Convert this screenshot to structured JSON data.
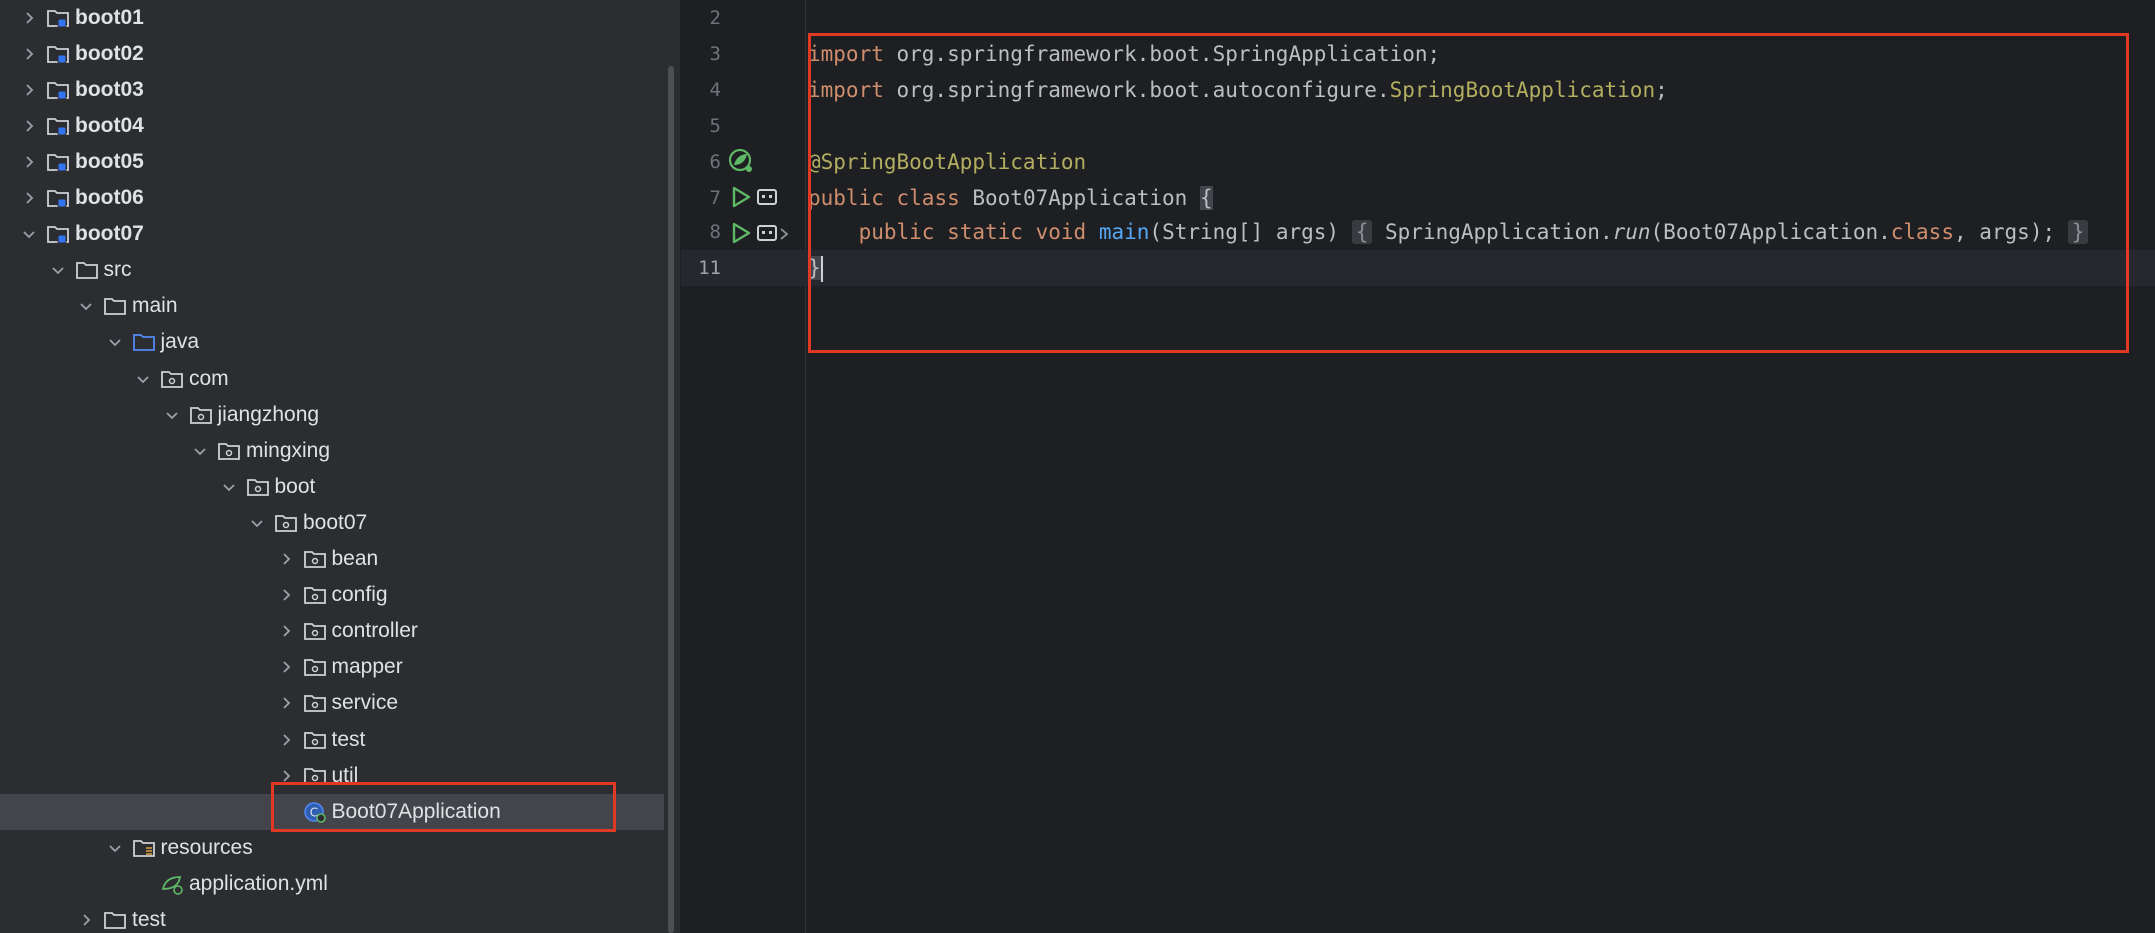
{
  "project_tree": {
    "items": [
      {
        "label": "boot01",
        "level": 0,
        "expanded": false,
        "icon": "module-folder-icon",
        "bold": true
      },
      {
        "label": "boot02",
        "level": 0,
        "expanded": false,
        "icon": "module-folder-icon",
        "bold": true
      },
      {
        "label": "boot03",
        "level": 0,
        "expanded": false,
        "icon": "module-folder-icon",
        "bold": true
      },
      {
        "label": "boot04",
        "level": 0,
        "expanded": false,
        "icon": "module-folder-icon",
        "bold": true
      },
      {
        "label": "boot05",
        "level": 0,
        "expanded": false,
        "icon": "module-folder-icon",
        "bold": true
      },
      {
        "label": "boot06",
        "level": 0,
        "expanded": false,
        "icon": "module-folder-icon",
        "bold": true
      },
      {
        "label": "boot07",
        "level": 0,
        "expanded": true,
        "icon": "module-folder-icon",
        "bold": true
      },
      {
        "label": "src",
        "level": 1,
        "expanded": true,
        "icon": "folder-icon"
      },
      {
        "label": "main",
        "level": 2,
        "expanded": true,
        "icon": "folder-icon"
      },
      {
        "label": "java",
        "level": 3,
        "expanded": true,
        "icon": "source-folder-icon"
      },
      {
        "label": "com",
        "level": 4,
        "expanded": true,
        "icon": "package-icon"
      },
      {
        "label": "jiangzhong",
        "level": 5,
        "expanded": true,
        "icon": "package-icon"
      },
      {
        "label": "mingxing",
        "level": 6,
        "expanded": true,
        "icon": "package-icon"
      },
      {
        "label": "boot",
        "level": 7,
        "expanded": true,
        "icon": "package-icon"
      },
      {
        "label": "boot07",
        "level": 8,
        "expanded": true,
        "icon": "package-icon"
      },
      {
        "label": "bean",
        "level": 9,
        "expanded": false,
        "icon": "package-icon"
      },
      {
        "label": "config",
        "level": 9,
        "expanded": false,
        "icon": "package-icon"
      },
      {
        "label": "controller",
        "level": 9,
        "expanded": false,
        "icon": "package-icon"
      },
      {
        "label": "mapper",
        "level": 9,
        "expanded": false,
        "icon": "package-icon"
      },
      {
        "label": "service",
        "level": 9,
        "expanded": false,
        "icon": "package-icon"
      },
      {
        "label": "test",
        "level": 9,
        "expanded": false,
        "icon": "package-icon"
      },
      {
        "label": "util",
        "level": 9,
        "expanded": false,
        "icon": "package-icon"
      },
      {
        "label": "Boot07Application",
        "level": 9,
        "leaf": true,
        "icon": "spring-class-icon",
        "selected": true
      },
      {
        "label": "resources",
        "level": 3,
        "expanded": true,
        "icon": "resources-folder-icon"
      },
      {
        "label": "application.yml",
        "level": 4,
        "leaf": true,
        "icon": "spring-config-icon"
      },
      {
        "label": "test",
        "level": 2,
        "expanded": false,
        "icon": "folder-icon"
      }
    ]
  },
  "editor": {
    "line_numbers": [
      "2",
      "3",
      "4",
      "5",
      "6",
      "7",
      "8",
      "11"
    ],
    "current_line": "11",
    "code": {
      "l3": {
        "kw": "import",
        "rest": " org.springframework.boot.SpringApplication;"
      },
      "l4": {
        "kw": "import",
        "rest_a": " org.springframework.boot.autoconfigure.",
        "ann": "SpringBootApplication",
        "rest_b": ";"
      },
      "l6": {
        "ann": "@SpringBootApplication"
      },
      "l7": {
        "kw1": "public",
        "kw2": "class",
        "name": " Boot07Application ",
        "brace": "{"
      },
      "l8": {
        "indent": "    ",
        "kw1": "public",
        "kw2": "static",
        "kw3": "void",
        "fn": "main",
        "params": "(String[] args) ",
        "fold_open": "{",
        "call_a": " SpringApplication.",
        "call_run": "run",
        "call_b": "(Boot07Application.",
        "call_class": "class",
        "call_c": ", args);",
        "fold_close": "}"
      },
      "l11": {
        "brace": "}"
      }
    }
  },
  "colors": {
    "highlight_box": "#e03a24",
    "keyword": "#cf8e6d",
    "annotation": "#b3ae60",
    "function": "#56a8f5",
    "run_icon": "#5fb865"
  }
}
